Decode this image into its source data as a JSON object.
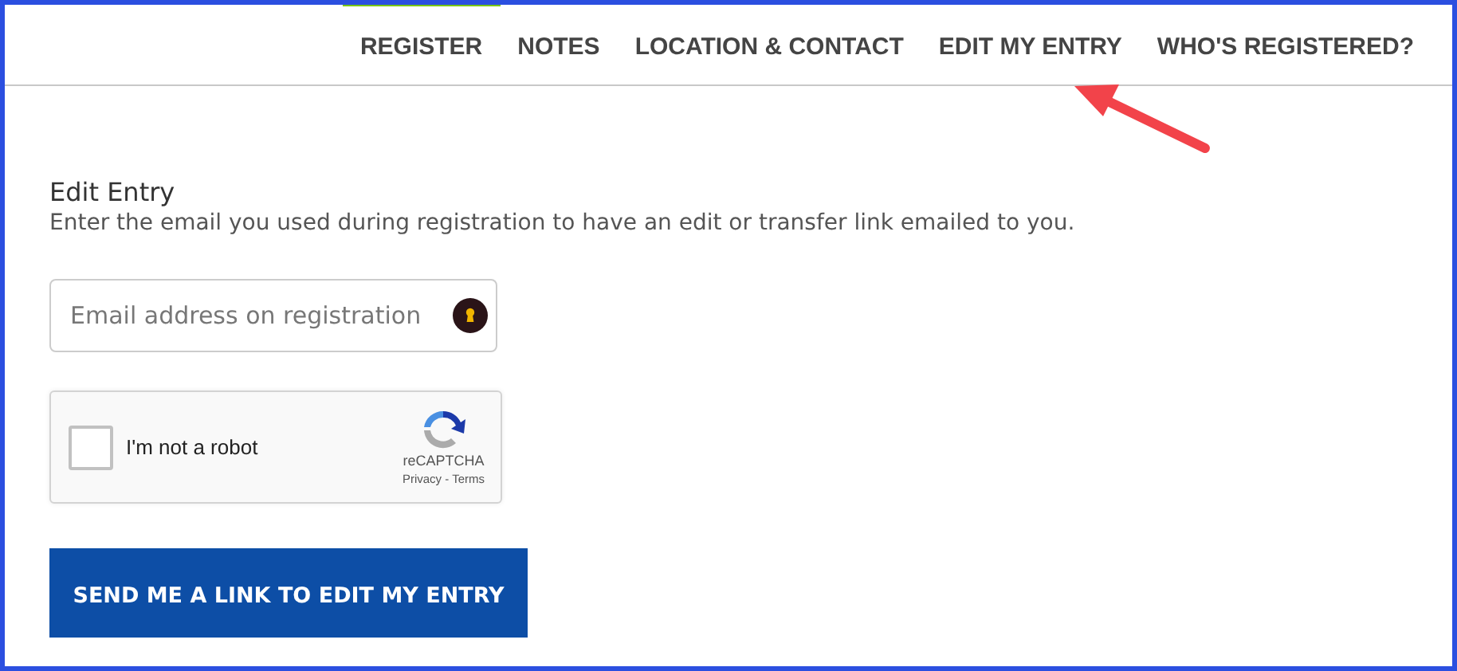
{
  "nav": [
    {
      "label": "REGISTER",
      "selected": true
    },
    {
      "label": "NOTES",
      "selected": false
    },
    {
      "label": "LOCATION & CONTACT",
      "selected": false
    },
    {
      "label": "EDIT MY ENTRY",
      "selected": false
    },
    {
      "label": "WHO'S REGISTERED?",
      "selected": false
    }
  ],
  "form": {
    "title": "Edit Entry",
    "description": "Enter the email you used during registration to have an edit or transfer link emailed to you.",
    "email": {
      "placeholder": "Email address on registration"
    },
    "captcha": {
      "label": "I'm not a robot",
      "checked": false,
      "brand": "reCAPTCHA",
      "links": "Privacy - Terms"
    },
    "submit": "SEND ME A LINK TO EDIT MY ENTRY"
  }
}
